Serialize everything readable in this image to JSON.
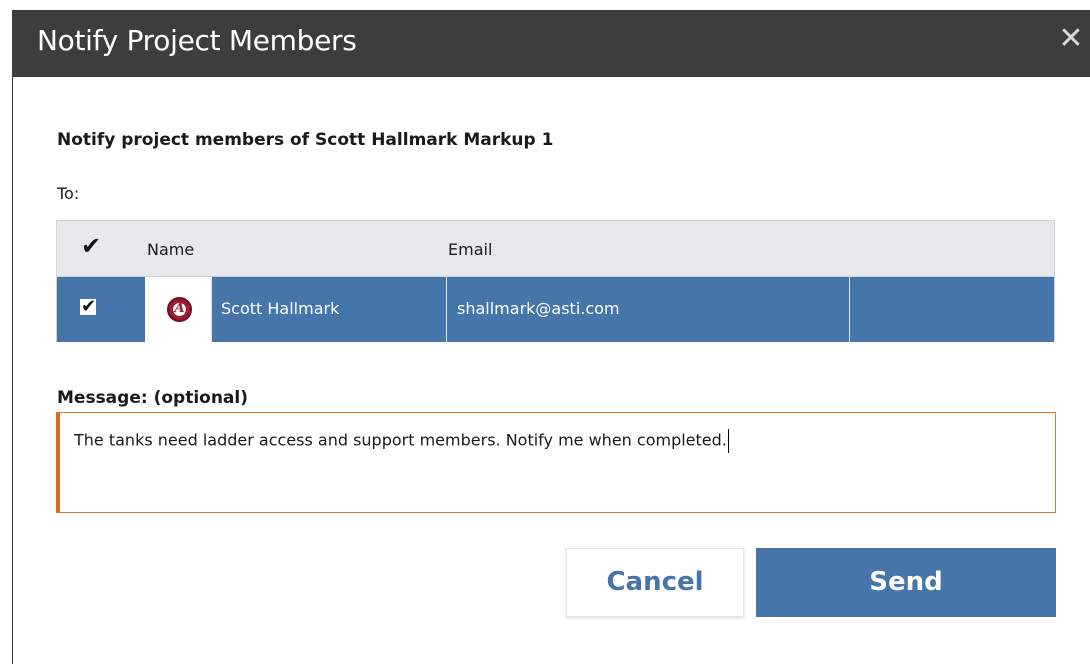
{
  "dialog": {
    "title": "Notify Project Members",
    "close_glyph": "✕",
    "heading": "Notify project members of Scott Hallmark Markup 1",
    "to_label": "To:"
  },
  "grid": {
    "header": {
      "select_all_checked": true,
      "name_label": "Name",
      "email_label": "Email"
    },
    "rows": [
      {
        "checked": true,
        "avatar_icon": "university-logo-icon",
        "avatar_letter": "A",
        "name": "Scott Hallmark",
        "email": "shallmark@asti.com"
      }
    ],
    "selected_row_color": "#4575a9"
  },
  "message": {
    "label": "Message: (optional)",
    "value": "The tanks need ladder access and support members.  Notify me when completed."
  },
  "buttons": {
    "cancel_label": "Cancel",
    "send_label": "Send"
  },
  "colors": {
    "titlebar": "#3d3d3d",
    "accent": "#4575a9",
    "focus_border": "#e0681a"
  }
}
